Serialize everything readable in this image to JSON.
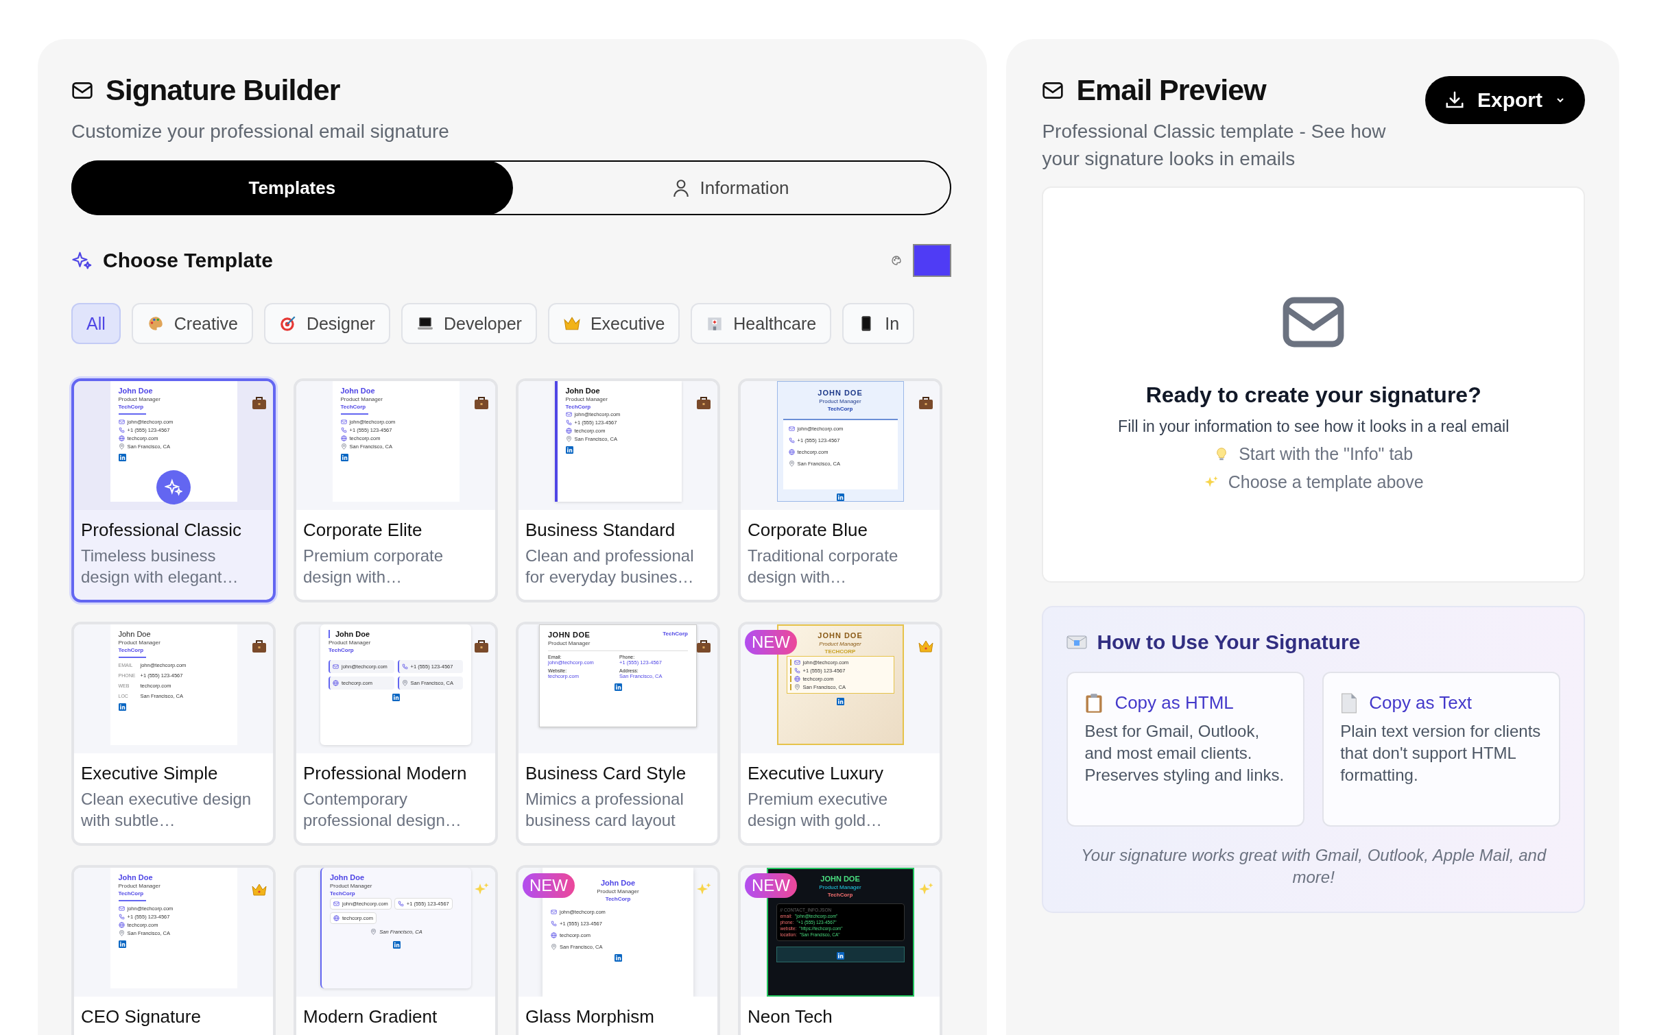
{
  "builder": {
    "title": "Signature Builder",
    "subtitle": "Customize your professional email signature",
    "tabs": [
      {
        "label": "Templates",
        "kind": "templates",
        "selected": true
      },
      {
        "label": "Information",
        "kind": "information",
        "selected": false
      }
    ],
    "section_title": "Choose Template",
    "filters": [
      {
        "label": "All",
        "kind": "all",
        "selected": true
      },
      {
        "label": "Creative",
        "kind": "creative",
        "selected": false
      },
      {
        "label": "Designer",
        "kind": "designer",
        "selected": false
      },
      {
        "label": "Developer",
        "kind": "developer",
        "selected": false
      },
      {
        "label": "Executive",
        "kind": "executive",
        "selected": false
      },
      {
        "label": "Healthcare",
        "kind": "healthcare",
        "selected": false
      },
      {
        "label": "In",
        "kind": "mobile",
        "selected": false
      }
    ],
    "templates": [
      {
        "name": "Professional Classic",
        "description": "Timeless business design with elegant…",
        "kind": "professional",
        "selected": true,
        "preview": {
          "name": "John Doe",
          "title": "Product Manager",
          "company": "TechCorp",
          "contacts": [
            {
              "text": "john@techcorp.com"
            },
            {
              "text": "+1 (555) 123-4567"
            },
            {
              "text": "techcorp.com"
            },
            {
              "text": "San Francisco, CA"
            }
          ]
        }
      },
      {
        "name": "Corporate Elite",
        "description": "Premium corporate design with…",
        "kind": "professional",
        "selected": false,
        "preview": {
          "name": "John Doe",
          "title": "Product Manager",
          "company": "TechCorp",
          "contacts": [
            {
              "text": "john@techcorp.com"
            },
            {
              "text": "+1 (555) 123-4567"
            },
            {
              "text": "techcorp.com"
            },
            {
              "text": "San Francisco, CA"
            }
          ]
        }
      },
      {
        "name": "Business Standard",
        "description": "Clean and professional for everyday busines…",
        "kind": "professional",
        "selected": false,
        "preview": {
          "name": "John Doe",
          "title": "Product Manager",
          "company": "TechCorp",
          "contacts": [
            {
              "text": "john@techcorp.com"
            },
            {
              "text": "+1 (555) 123-4567"
            },
            {
              "text": "techcorp.com"
            },
            {
              "text": "San Francisco, CA"
            }
          ]
        }
      },
      {
        "name": "Corporate Blue",
        "description": "Traditional corporate design with…",
        "kind": "professional",
        "selected": false,
        "preview": {
          "name": "JOHN DOE",
          "title": "Product Manager",
          "company": "TechCorp",
          "contacts": [
            {
              "text": "john@techcorp.com"
            },
            {
              "text": "+1 (555) 123-4567"
            },
            {
              "text": "techcorp.com"
            },
            {
              "text": "San Francisco, CA"
            }
          ]
        }
      },
      {
        "name": "Executive Simple",
        "description": "Clean executive design with subtle…",
        "kind": "professional",
        "selected": false,
        "preview": {
          "name": "John Doe",
          "title": "Product Manager",
          "company": "TechCorp",
          "contacts": [
            {
              "label": "EMAIL",
              "text": "john@techcorp.com"
            },
            {
              "label": "PHONE",
              "text": "+1 (555) 123-4567"
            },
            {
              "label": "WEB",
              "text": "techcorp.com"
            },
            {
              "label": "LOC",
              "text": "San Francisco, CA"
            }
          ]
        }
      },
      {
        "name": "Professional Modern",
        "description": "Contemporary professional design…",
        "kind": "professional",
        "selected": false,
        "preview": {
          "name": "John Doe",
          "title": "Product Manager",
          "company": "TechCorp",
          "contacts": [
            {
              "text": "john@techcorp.com"
            },
            {
              "text": "+1 (555) 123-4567"
            },
            {
              "text": "techcorp.com"
            },
            {
              "text": "San Francisco, CA"
            }
          ]
        }
      },
      {
        "name": "Business Card Style",
        "description": "Mimics a professional business card layout",
        "kind": "professional",
        "selected": false,
        "preview": {
          "name": "JOHN DOE",
          "title": "Product Manager",
          "company": "TechCorp",
          "contacts": [
            {
              "label": "Email:",
              "text": "john@techcorp.com"
            },
            {
              "label": "Phone:",
              "text": "+1 (555) 123-4567"
            },
            {
              "label": "Website:",
              "text": "techcorp.com"
            },
            {
              "label": "Address:",
              "text": "San Francisco, CA"
            }
          ]
        }
      },
      {
        "name": "Executive Luxury",
        "description": "Premium executive design with gold…",
        "kind": "executive",
        "badge": "NEW",
        "selected": false,
        "preview": {
          "name": "JOHN DOE",
          "title": "Product Manager",
          "company": "TECHCORP",
          "contacts": [
            {
              "text": "john@techcorp.com"
            },
            {
              "text": "+1 (555) 123-4567"
            },
            {
              "text": "techcorp.com"
            },
            {
              "text": "San Francisco, CA"
            }
          ]
        }
      },
      {
        "name": "CEO Signature",
        "kind": "executive",
        "selected": false,
        "preview": {
          "name": "John Doe",
          "title": "Product Manager",
          "company": "TechCorp",
          "contacts": [
            {
              "text": "john@techcorp.com"
            },
            {
              "text": "+1 (555) 123-4567"
            },
            {
              "text": "techcorp.com"
            },
            {
              "text": "San Francisco, CA"
            }
          ]
        }
      },
      {
        "name": "Modern Gradient",
        "kind": "modern",
        "selected": false,
        "preview": {
          "name": "John Doe",
          "title": "Product Manager",
          "company": "TechCorp",
          "contacts": [
            {
              "text": "john@techcorp.com"
            },
            {
              "text": "+1 (555) 123-4567"
            },
            {
              "text": "techcorp.com"
            },
            {
              "text": "San Francisco, CA"
            }
          ]
        }
      },
      {
        "name": "Glass Morphism",
        "kind": "modern",
        "badge": "NEW",
        "selected": false,
        "preview": {
          "name": "John Doe",
          "title": "Product Manager",
          "company": "TechCorp",
          "contacts": [
            {
              "text": "john@techcorp.com"
            },
            {
              "text": "+1 (555) 123-4567"
            },
            {
              "text": "techcorp.com"
            },
            {
              "text": "San Francisco, CA"
            }
          ]
        }
      },
      {
        "name": "Neon Tech",
        "kind": "modern",
        "badge": "NEW",
        "selected": false,
        "preview": {
          "name": "JOHN DOE",
          "title": "Product Manager",
          "company": "TechCorp",
          "code_header": "// CONTACT_INFO.JSON",
          "contacts": [
            {
              "label": "email:",
              "text": "\"john@techcorp.com\""
            },
            {
              "label": "phone:",
              "text": "\"+1 (555) 123-4567\""
            },
            {
              "label": "website:",
              "text": "\"https://techcorp.com\""
            },
            {
              "label": "location:",
              "text": "\"San Francisco, CA\""
            }
          ]
        }
      }
    ]
  },
  "preview": {
    "title": "Email Preview",
    "subtitle": "Professional Classic template - See how your signature looks in emails",
    "export_button": "Export",
    "empty_title": "Ready to create your signature?",
    "empty_text": "Fill in your information to see how it looks in a real email",
    "tips": [
      {
        "kind": "idea",
        "text": "Start with the \"Info\" tab"
      },
      {
        "kind": "sparkle",
        "text": "Choose a template above"
      }
    ]
  },
  "how_to": {
    "title": "How to Use Your Signature",
    "options": [
      {
        "kind": "html",
        "title": "Copy as HTML",
        "text": "Best for Gmail, Outlook, and most email clients. Preserves styling and links."
      },
      {
        "kind": "text",
        "title": "Copy as Text",
        "text": "Plain text version for clients that don't support HTML formatting."
      }
    ],
    "note": "Your signature works great with Gmail, Outlook, Apple Mail, and more!"
  }
}
